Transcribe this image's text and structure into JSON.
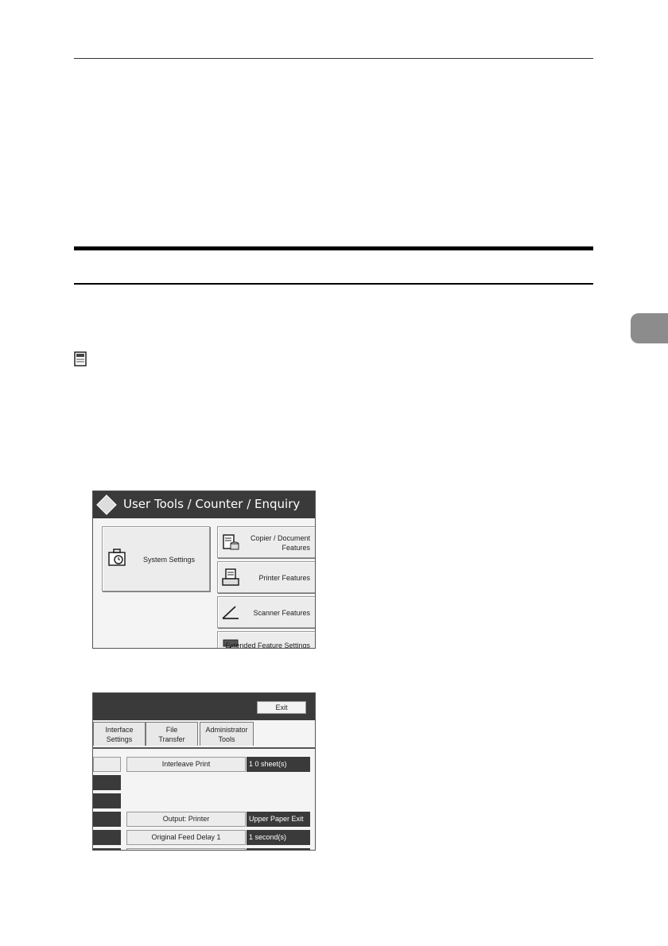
{
  "screen1": {
    "title": "User Tools / Counter / Enquiry",
    "buttons": {
      "system_settings": "System Settings",
      "copier_line1": "Copier / Document",
      "copier_line2": "Features",
      "printer": "Printer Features",
      "scanner": "Scanner Features",
      "extended": "Extended Feature Settings"
    },
    "icons": [
      "logo-icon",
      "toolbox-icon",
      "copier-icon",
      "printer-icon",
      "scanner-icon",
      "extended-feature-icon"
    ]
  },
  "screen2": {
    "exit_label": "Exit",
    "tabs": [
      {
        "line1": "Interface",
        "line2": "Settings"
      },
      {
        "line1": "File",
        "line2": "Transfer"
      },
      {
        "line1": "Administrator",
        "line2": "Tools"
      }
    ],
    "settings": [
      {
        "label": "Interleave Print",
        "value": "1 0  sheet(s)"
      },
      {
        "label": "Output: Printer",
        "value": "Upper Paper Exit"
      },
      {
        "label": "Original Feed Delay 1",
        "value": "1  second(s)"
      }
    ]
  },
  "colors": {
    "title_bar": "#3a3a3a",
    "button_face": "#ececec",
    "side_tab": "#8c8c8c"
  }
}
